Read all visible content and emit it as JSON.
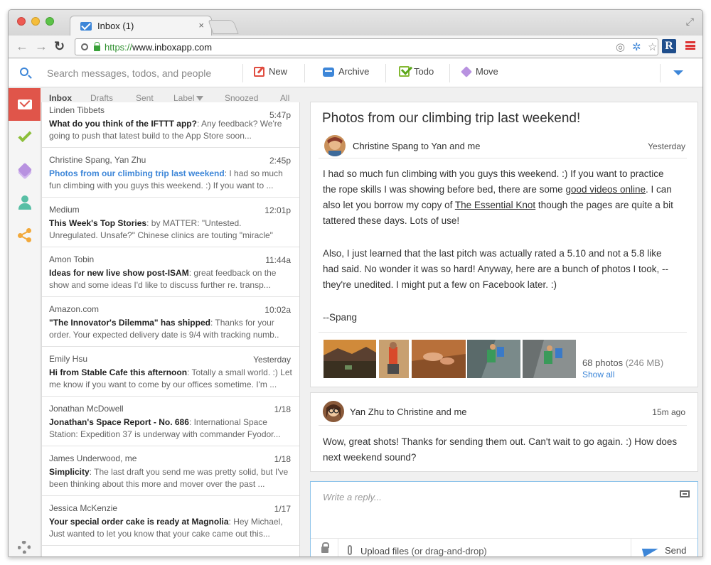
{
  "browser": {
    "tab_title": "Inbox (1)",
    "tab_close": "×",
    "url_scheme": "https://",
    "url_rest": "www.inboxapp.com",
    "ext_label": "R"
  },
  "toolbar": {
    "search_placeholder": "Search messages, todos, and people",
    "new_label": "New",
    "archive_label": "Archive",
    "todo_label": "Todo",
    "move_label": "Move"
  },
  "list_tabs": {
    "inbox": "Inbox",
    "drafts": "Drafts",
    "sent": "Sent",
    "label": "Label",
    "snoozed": "Snoozed",
    "all": "All"
  },
  "messages": [
    {
      "from": "Linden Tibbets",
      "time": "5:47p",
      "subject": "What do you think of the IFTTT app?",
      "preview": ": Any feedback? We're going to push that latest build to the App Store soon..."
    },
    {
      "from": "Christine Spang, Yan Zhu",
      "time": "2:45p",
      "subject": "Photos from our climbing trip last weekend",
      "preview": ": I had so much fun climbing with you guys this weekend. :) If you want to ..."
    },
    {
      "from": "Medium",
      "time": "12:01p",
      "subject": "This Week's Top Stories",
      "preview": ": by MATTER: \"Untested. Unregulated. Unsafe?\" Chinese clinics are touting \"miracle\" stem cell ..."
    },
    {
      "from": "Amon Tobin",
      "time": "11:44a",
      "subject": "Ideas for new live show post-ISAM",
      "preview": ": great feedback on the show and some ideas I'd like to discuss further re. transp..."
    },
    {
      "from": "Amazon.com",
      "time": "10:02a",
      "subject": "\"The Innovator's Dilemma\" has shipped",
      "preview": ": Thanks for your order. Your expected delivery date is 9/4 with tracking numb.."
    },
    {
      "from": "Emily Hsu",
      "time": "Yesterday",
      "subject": "Hi from Stable Cafe this afternoon",
      "preview": ": Totally a small world. :) Let me know if you want to come by our offices sometime. I'm ..."
    },
    {
      "from": "Jonathan McDowell",
      "time": "1/18",
      "subject": "Jonathan's Space Report - No. 686",
      "preview": ": International Space Station: Expedition 37 is underway with commander Fyodor..."
    },
    {
      "from": "James Underwood, me",
      "time": "1/18",
      "subject": "Simplicity",
      "preview": ": The last draft you send me was pretty solid, but I've been thinking about this more and mover over the past ..."
    },
    {
      "from": "Jessica McKenzie",
      "time": "1/17",
      "subject": "Your special order cake is ready at Magnolia",
      "preview": ": Hey Michael, Just wanted to let you know that your cake came out this..."
    }
  ],
  "thread": {
    "title": "Photos from our climbing trip last weekend!",
    "msg1": {
      "sender": "Christine Spang",
      "recipients": " to Yan and me",
      "date": "Yesterday",
      "p1a": "I had so much fun climbing with you guys this weekend. :) If you want to practice the rope skills I was showing before bed, there are some ",
      "p1_link1": "good videos online",
      "p1b": ". I can also let you borrow my copy of ",
      "p1_link2": "The Essential Knot",
      "p1c": " though the pages are quite a bit tattered these days. Lots of use!",
      "p2": "Also, I just learned that the last pitch was actually rated a 5.10 and not a 5.8 like had said. No wonder it was so hard! Anyway, here are a bunch of photos I took, --they're unedited. I might put a few on Facebook later. :)",
      "sig": "--Spang",
      "photos_count": "68 photos",
      "photos_size": " (246 MB)",
      "show_all": "Show all"
    },
    "msg2": {
      "sender": "Yan Zhu",
      "recipients": " to Christine and me",
      "date": "15m ago",
      "body": "Wow, great shots! Thanks for sending them out. Can't wait to go again. :) How does next weekend sound?"
    }
  },
  "reply": {
    "placeholder": "Write a reply...",
    "upload_label": "Upload files",
    "upload_hint": "  (or drag-and-drop)",
    "send_label": "Send"
  }
}
